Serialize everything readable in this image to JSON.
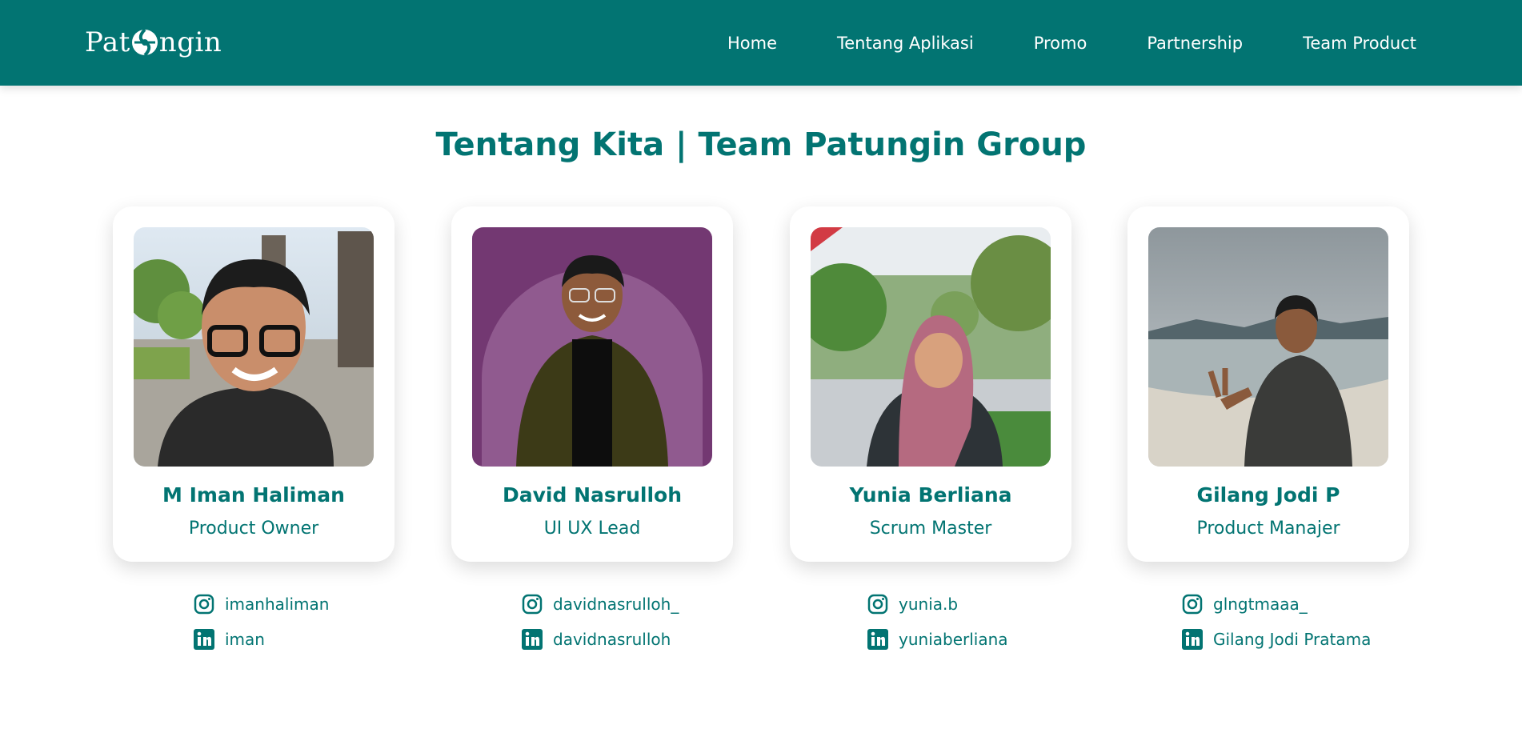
{
  "brand": {
    "logo_text_left": "Pat",
    "logo_text_right": "ngin",
    "color": "#027472"
  },
  "nav": {
    "items": [
      "Home",
      "Tentang Aplikasi",
      "Promo",
      "Partnership",
      "Team Product"
    ]
  },
  "page": {
    "title": "Tentang Kita | Team Patungin Group"
  },
  "team": [
    {
      "name": "M Iman Haliman",
      "role": "Product Owner",
      "instagram": "imanhaliman",
      "linkedin": "iman"
    },
    {
      "name": "David Nasrulloh",
      "role": "UI UX Lead",
      "instagram": "davidnasrulloh_",
      "linkedin": "davidnasrulloh"
    },
    {
      "name": "Yunia Berliana",
      "role": "Scrum Master",
      "instagram": "yunia.b",
      "linkedin": "yuniaberliana"
    },
    {
      "name": "Gilang Jodi P",
      "role": "Product Manajer",
      "instagram": "glngtmaaa_",
      "linkedin": "Gilang Jodi Pratama"
    }
  ],
  "icons": {
    "social_1": "instagram-icon",
    "social_2": "linkedin-icon"
  }
}
